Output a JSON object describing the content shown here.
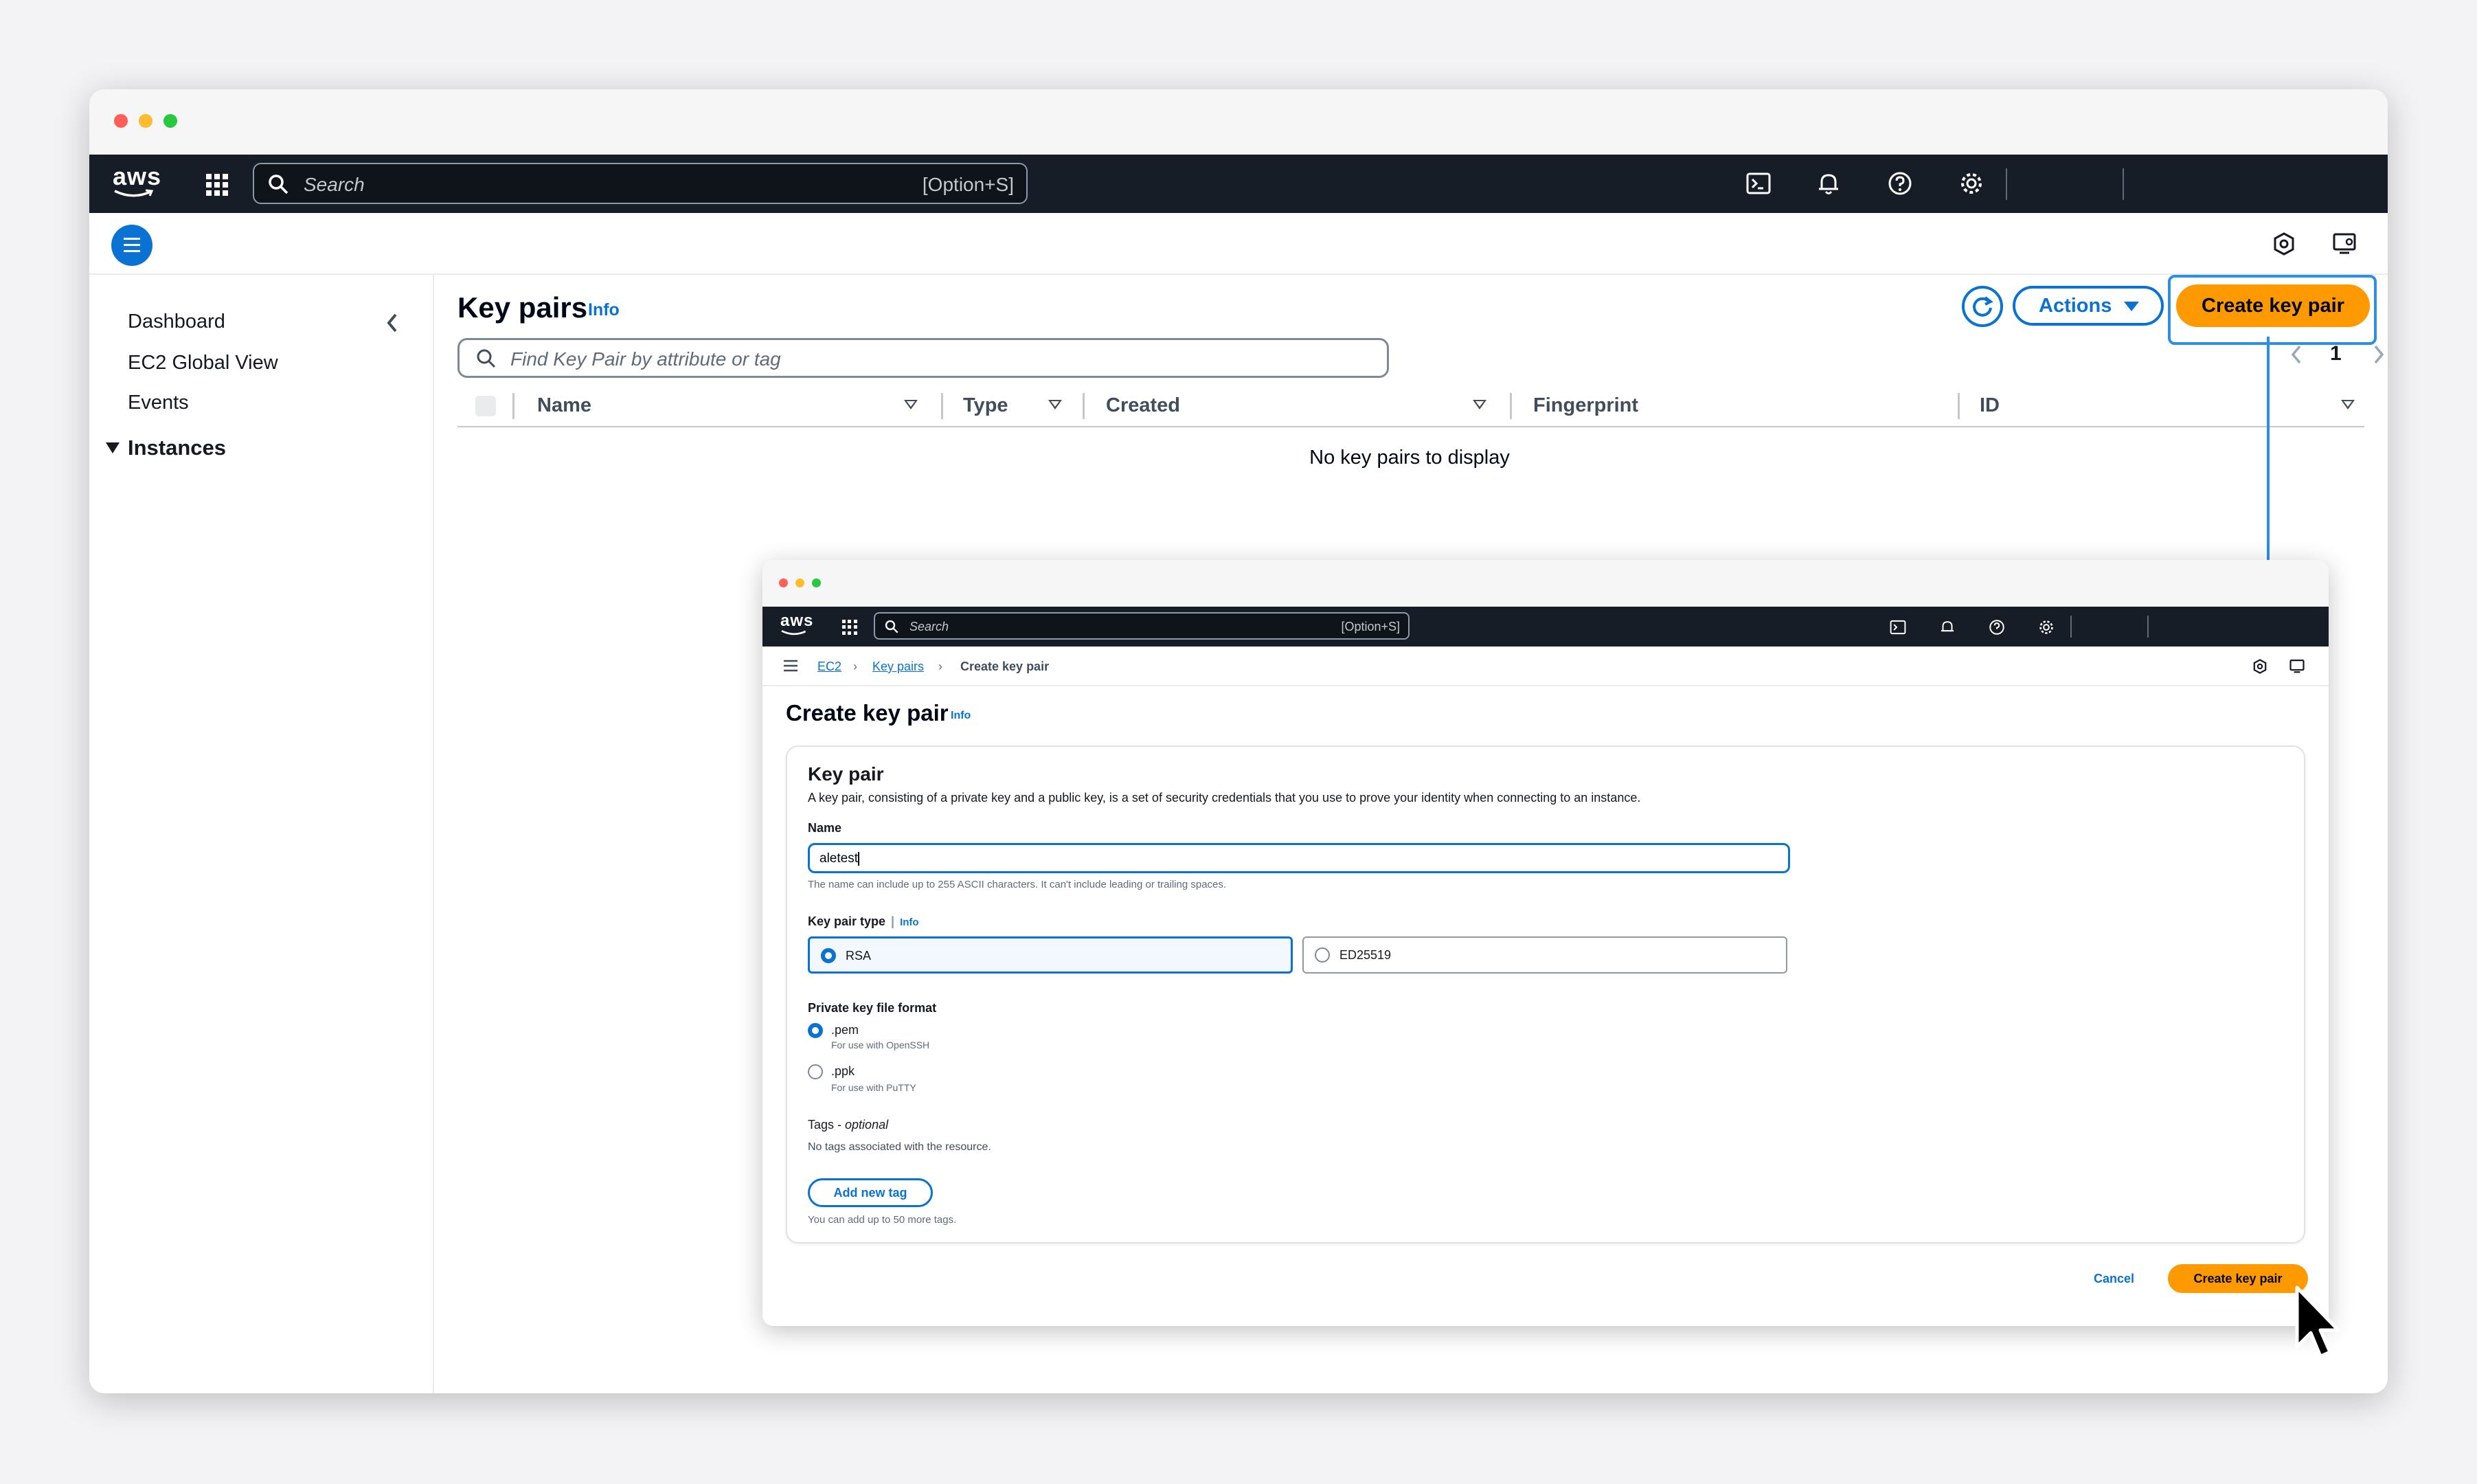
{
  "main": {
    "topnav": {
      "logo": "aws",
      "search_placeholder": "Search",
      "search_shortcut": "[Option+S]"
    },
    "sidebar": {
      "items": [
        {
          "label": "Dashboard"
        },
        {
          "label": "EC2 Global View"
        },
        {
          "label": "Events"
        }
      ],
      "group": "Instances"
    },
    "page": {
      "title": "Key pairs",
      "info": "Info",
      "filter_placeholder": "Find Key Pair by attribute or tag",
      "actions_label": "Actions",
      "create_label": "Create key pair",
      "page_number": "1",
      "columns": [
        "Name",
        "Type",
        "Created",
        "Fingerprint",
        "ID"
      ],
      "empty_text": "No key pairs to display"
    }
  },
  "inset": {
    "topnav": {
      "logo": "aws",
      "search_placeholder": "Search",
      "search_shortcut": "[Option+S]"
    },
    "breadcrumb": [
      "EC2",
      "Key pairs",
      "Create key pair"
    ],
    "title": "Create key pair",
    "info": "Info",
    "panel": {
      "heading": "Key pair",
      "description": "A key pair, consisting of a private key and a public key, is a set of security credentials that you use to prove your identity when connecting to an instance.",
      "name_label": "Name",
      "name_value": "aletest",
      "name_hint": "The name can include up to 255 ASCII characters. It can't include leading or trailing spaces.",
      "type_label": "Key pair type",
      "type_info": "Info",
      "type_options": [
        "RSA",
        "ED25519"
      ],
      "type_selected": "RSA",
      "format_label": "Private key file format",
      "formats": [
        {
          "label": ".pem",
          "sub": "For use with OpenSSH"
        },
        {
          "label": ".ppk",
          "sub": "For use with PuTTY"
        }
      ],
      "format_selected": ".pem",
      "tags_label": "Tags - ",
      "tags_optional": "optional",
      "tags_empty": "No tags associated with the resource.",
      "add_tag_label": "Add new tag",
      "tags_hint": "You can add up to 50 more tags."
    },
    "cancel_label": "Cancel",
    "create_label": "Create key pair"
  },
  "colors": {
    "accent": "#0972d3",
    "primary": "#ff9900",
    "nav": "#161d26",
    "highlight": "#2c8fe0"
  }
}
